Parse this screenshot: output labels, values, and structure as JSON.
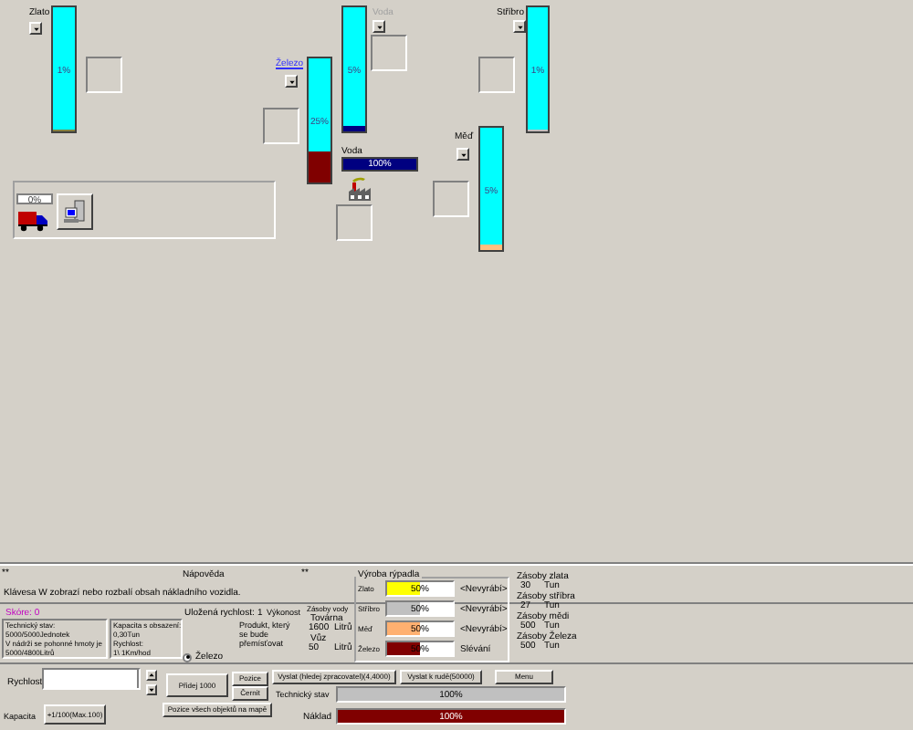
{
  "map": {
    "resources": [
      {
        "name": "Zlato",
        "selected": false,
        "disabled": false,
        "level": 0.02,
        "reading": "1%",
        "color": "#808040"
      },
      {
        "name": "Voda",
        "selected": false,
        "disabled": true,
        "level": 0.05,
        "reading": "5%",
        "color": "#000080"
      },
      {
        "name": "Železo",
        "selected": true,
        "disabled": false,
        "level": 0.25,
        "reading": "25%",
        "color": "#800000"
      },
      {
        "name": "Stříbro",
        "selected": false,
        "disabled": false,
        "level": 0.01,
        "reading": "1%",
        "color": "#c0c0c0"
      },
      {
        "name": "Měď",
        "selected": false,
        "disabled": false,
        "level": 0.05,
        "reading": "5%",
        "color": "#ffc080"
      }
    ],
    "water_tank": {
      "name": "Voda",
      "level": 1,
      "reading": "100%"
    },
    "vehicle_panel": {
      "cargo_reading": "0%"
    }
  },
  "help": {
    "left_mark": "**",
    "title": "Nápověda",
    "right_mark": "**",
    "text": "Klávesa W zobrazí nebo rozbalí obsah nákladního vozidla."
  },
  "score": "Skóre: 0",
  "saved_speed": {
    "label": "Uložená rychlost:",
    "value": "1"
  },
  "power_label": "Výkonost",
  "tech_info": [
    "Technický stav:",
    "5000/5000Jednotek",
    "V nádrži se pohonné hmoty je",
    "5000/4800Litrů"
  ],
  "cargo_info": [
    "Kapacita s obsazení:",
    "0,30Tun",
    "Rychlost:",
    "1\\ 1Km/hod"
  ],
  "product": {
    "caption": "Produkt, který se bude přemísťovat",
    "options": [
      {
        "label": "Železo",
        "selected": true
      }
    ]
  },
  "water_stock": {
    "title": "Zásoby vody",
    "rows": [
      {
        "label": "Továrna",
        "value": "1600",
        "unit": "Litrů"
      },
      {
        "label": "Vůz",
        "value": "50",
        "unit": "Litrů"
      }
    ]
  },
  "production": {
    "title": "Výroba rýpadla",
    "rows": [
      {
        "name": "Zlato",
        "level": 0.5,
        "reading": "50%",
        "color": "#ffff00",
        "status": "<Nevyrábí>"
      },
      {
        "name": "Stříbro",
        "level": 0.5,
        "reading": "50%",
        "color": "#c0c0c0",
        "status": "<Nevyrábí>"
      },
      {
        "name": "Měď",
        "level": 0.5,
        "reading": "50%",
        "color": "#ffb070",
        "status": "<Nevyrábí>"
      },
      {
        "name": "Železo",
        "level": 0.5,
        "reading": "50%",
        "color": "#800000",
        "status": "Slévání"
      }
    ]
  },
  "reserves": [
    {
      "label": "Zásoby zlata",
      "value": "30",
      "unit": "Tun"
    },
    {
      "label": "Zásoby stříbra",
      "value": "27",
      "unit": "Tun"
    },
    {
      "label": "Zásoby mědi",
      "value": "500",
      "unit": "Tun"
    },
    {
      "label": "Zásoby Železa",
      "value": "500",
      "unit": "Tun"
    }
  ],
  "controls": {
    "speed_label": "Rychlost",
    "add_button": "Přidej 1000",
    "position_button": "Pozice",
    "clear_button": "Černit",
    "all_positions_button": "Pozice všech objektů na mapě",
    "capacity_label": "Kapacita",
    "capacity_button": "+1/100(Max.100)",
    "send_processor_button": "Vyslat (hledej zpracovatel)(4,4000)",
    "send_ore_button": "Vyslat k rudě(50000)",
    "menu_button": "Menu"
  },
  "status": {
    "tech": {
      "label": "Technický stav",
      "level": 1,
      "reading": "100%"
    },
    "cargo": {
      "label": "Náklad",
      "level": 1,
      "reading": "100%"
    }
  }
}
